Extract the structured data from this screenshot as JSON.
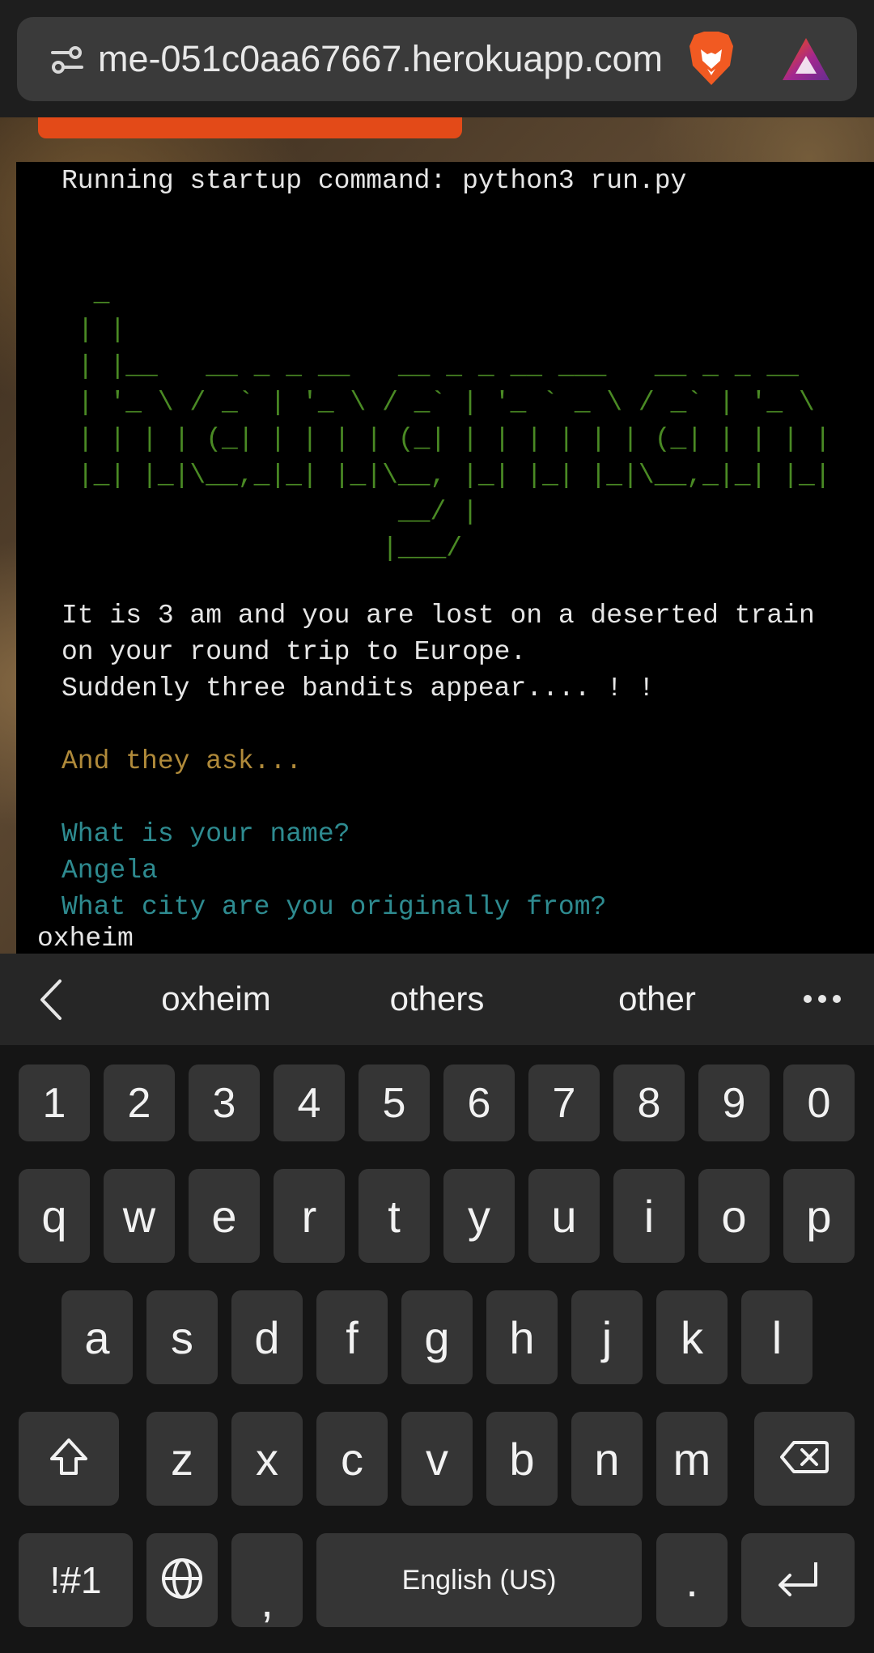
{
  "browser": {
    "url": "me-051c0aa67667.herokuapp.com",
    "icons": [
      "site-settings-icon",
      "brave-lion-icon",
      "brave-rewards-icon"
    ]
  },
  "terminal": {
    "startup_line": "Running startup command: python3 run.py",
    "ascii_art": "  _\n | |\n | |__   __ _ _ __   __ _ _ __ ___   __ _ _ __\n | '_ \\ / _` | '_ \\ / _` | '_ ` _ \\ / _` | '_ \\\n | | | | (_| | | | | (_| | | | | | | (_| | | | |\n |_| |_|\\__,_|_| |_|\\__, |_| |_| |_|\\__,_|_| |_|\n                     __/ |\n                    |___/",
    "story_line_1": "It is 3 am and you are lost on a deserted train",
    "story_line_2": "on your round trip to Europe.",
    "story_line_3": "Suddenly three bandits appear.... ! !",
    "they_ask": "And they ask...",
    "question_name": "What is your name?",
    "answer_name": "Angela",
    "question_city": "What city are you originally from?",
    "typed_input": "oxheim"
  },
  "keyboard": {
    "suggestions": [
      "oxheim",
      "others",
      "other"
    ],
    "number_row": [
      "1",
      "2",
      "3",
      "4",
      "5",
      "6",
      "7",
      "8",
      "9",
      "0"
    ],
    "row1": [
      "q",
      "w",
      "e",
      "r",
      "t",
      "y",
      "u",
      "i",
      "o",
      "p"
    ],
    "row2": [
      "a",
      "s",
      "d",
      "f",
      "g",
      "h",
      "j",
      "k",
      "l"
    ],
    "row3": [
      "z",
      "x",
      "c",
      "v",
      "b",
      "n",
      "m"
    ],
    "symbols_label": "!#1",
    "comma_label": ",",
    "space_label": "English (US)",
    "period_label": ".",
    "accent_color": "#e34a18"
  }
}
